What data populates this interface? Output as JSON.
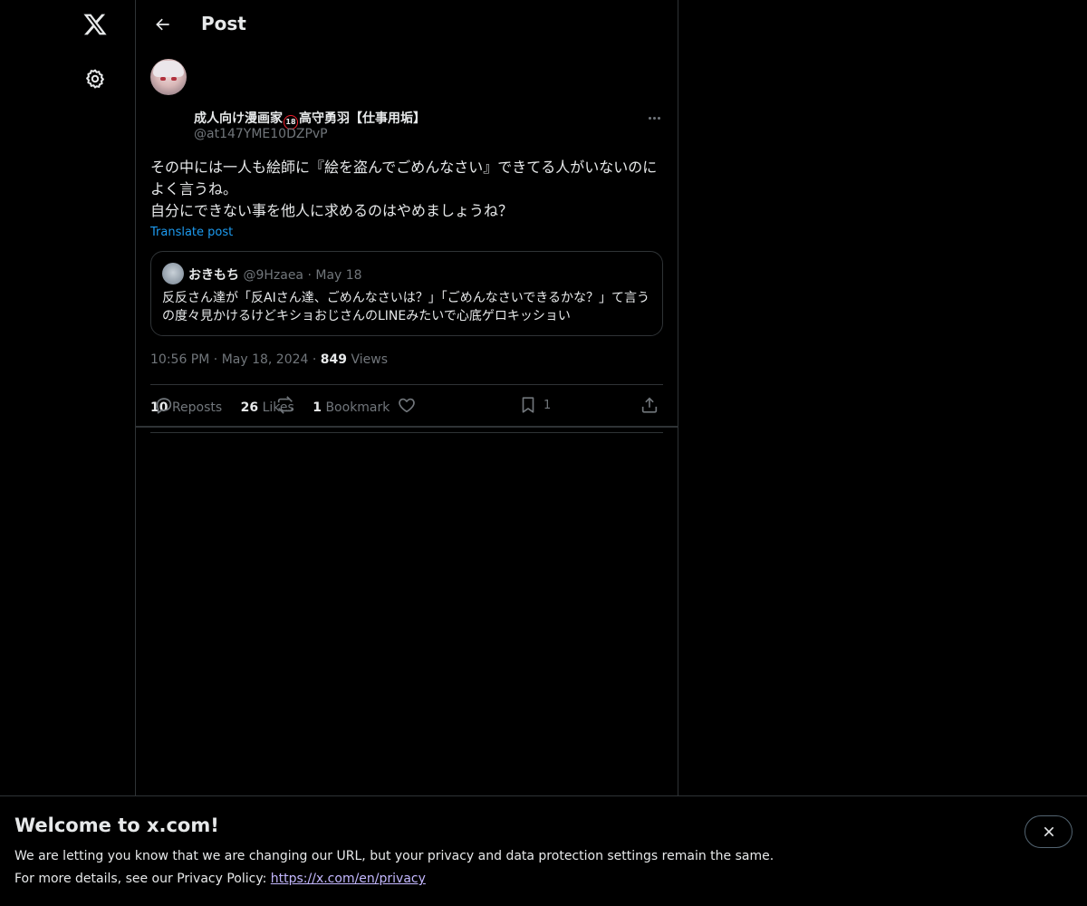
{
  "header": {
    "title": "Post"
  },
  "post": {
    "author_name_part1": "成人向け漫画家",
    "age_badge": "18",
    "author_name_part2": "高守勇羽【仕事用垢】",
    "author_handle": "@at147YME10DZPvP",
    "text": "その中には一人も絵師に『絵を盗んでごめんなさい』できてる人がいないのによく言うね。\n自分にできない事を他人に求めるのはやめましょうね？",
    "translate_label": "Translate post",
    "time": "10:56 PM",
    "date": "May 18, 2024",
    "views_count": "849",
    "views_label": "Views",
    "dot": "·"
  },
  "quote": {
    "name": "おきもち",
    "handle": "@9Hzaea",
    "dot": "·",
    "date": "May 18",
    "text": "反反さん達が「反AIさん達、ごめんなさいは？」「ごめんなさいできるかな？」て言うの度々見かけるけどキショおじさんのLINEみたいで心底ゲロキッショい"
  },
  "stats": {
    "reposts_count": "10",
    "reposts_label": "Reposts",
    "likes_count": "26",
    "likes_label": "Likes",
    "bookmarks_count": "1",
    "bookmarks_label": "Bookmark"
  },
  "actions": {
    "bookmark_count": "1"
  },
  "banner": {
    "title": "Welcome to x.com!",
    "line1": "We are letting you know that we are changing our URL, but your privacy and data protection settings remain the same.",
    "line2_prefix": "For more details, see our Privacy Policy: ",
    "link": "https://x.com/en/privacy"
  },
  "colors": {
    "accent": "#1d9bf0",
    "muted": "#71767b",
    "border": "#2f3336",
    "badge": "#f4212e",
    "link": "#c4b8ff"
  },
  "icons": [
    "x-logo-icon",
    "settings-gear-icon",
    "back-arrow-icon",
    "more-dots-icon",
    "reply-icon",
    "repost-icon",
    "like-heart-icon",
    "bookmark-icon",
    "share-icon",
    "close-icon"
  ]
}
